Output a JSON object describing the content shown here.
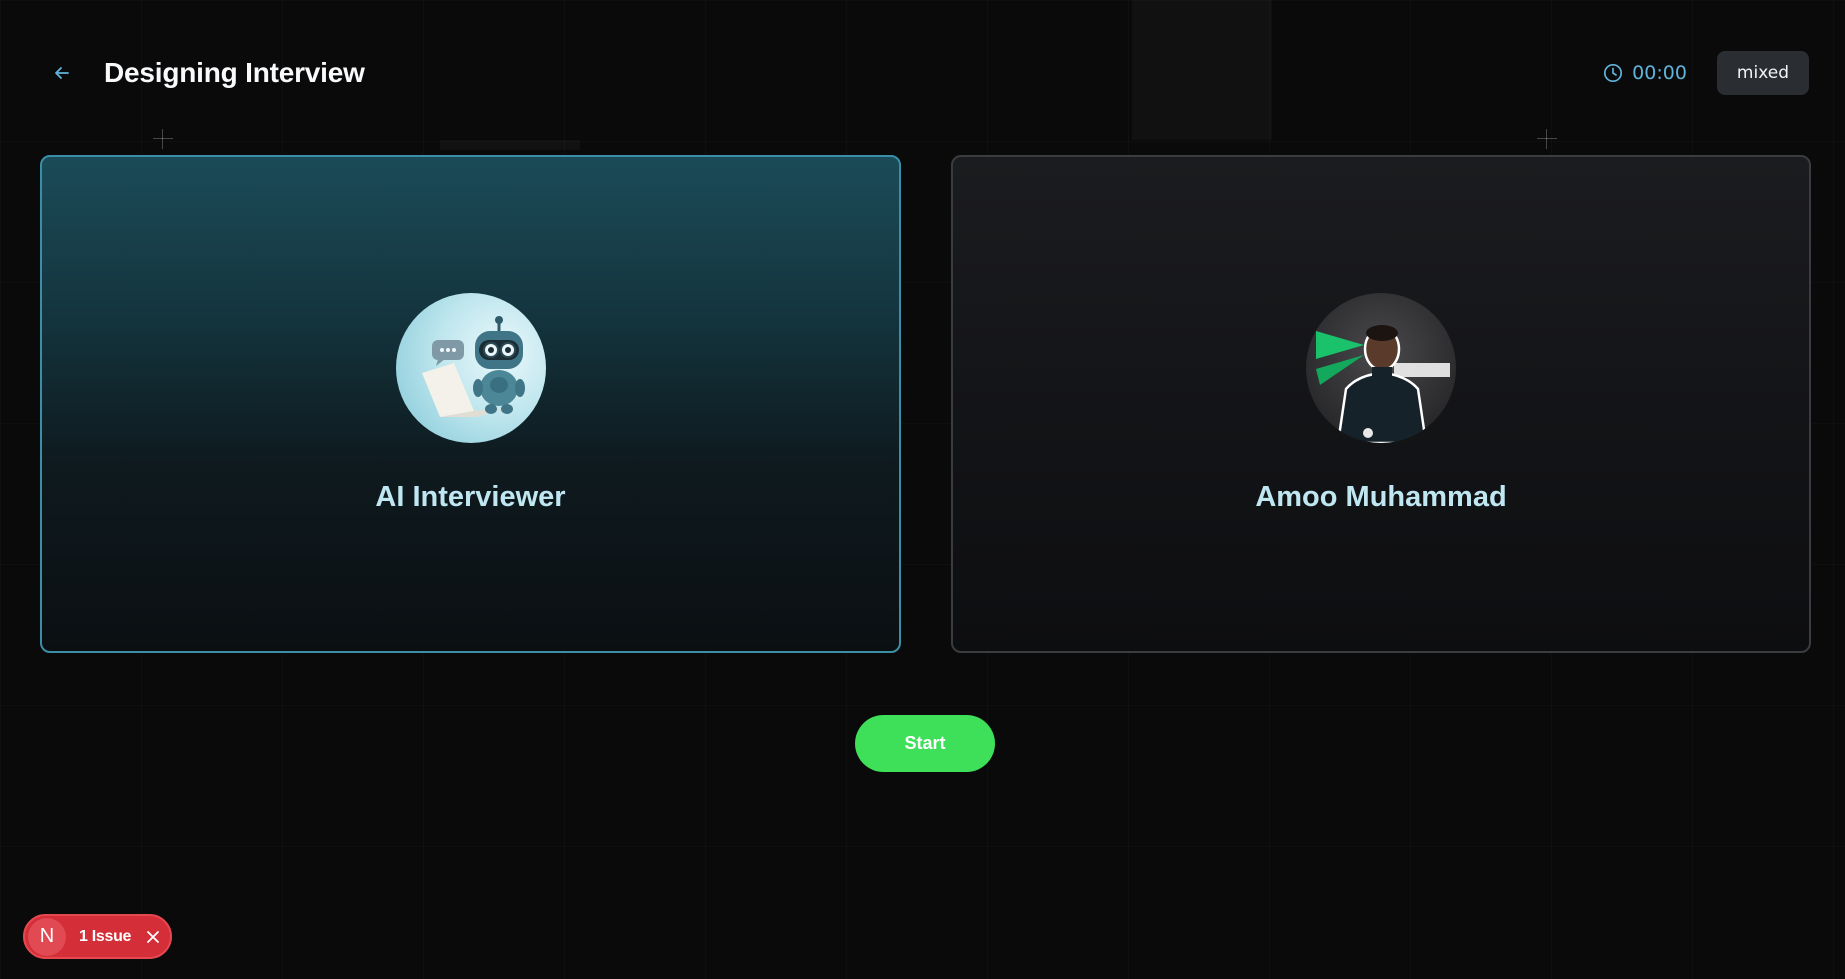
{
  "header": {
    "title": "Designing Interview",
    "back_icon": "arrow-left-icon",
    "timer": {
      "icon": "clock-icon",
      "value": "00:00"
    },
    "mode": "mixed"
  },
  "participants": {
    "ai": {
      "name": "AI Interviewer",
      "avatar": "robot-laptop-illustration"
    },
    "user": {
      "name": "Amoo Muhammad",
      "avatar": "user-photo"
    }
  },
  "actions": {
    "start_label": "Start"
  },
  "dev_overlay": {
    "logo": "N",
    "issue_label": "1 Issue",
    "close_icon": "close-icon"
  },
  "colors": {
    "accent": "#5fb4dc",
    "start_button": "#3ee05a",
    "issue_badge": "#d42e38",
    "ai_card_border": "#3a8ea6"
  }
}
